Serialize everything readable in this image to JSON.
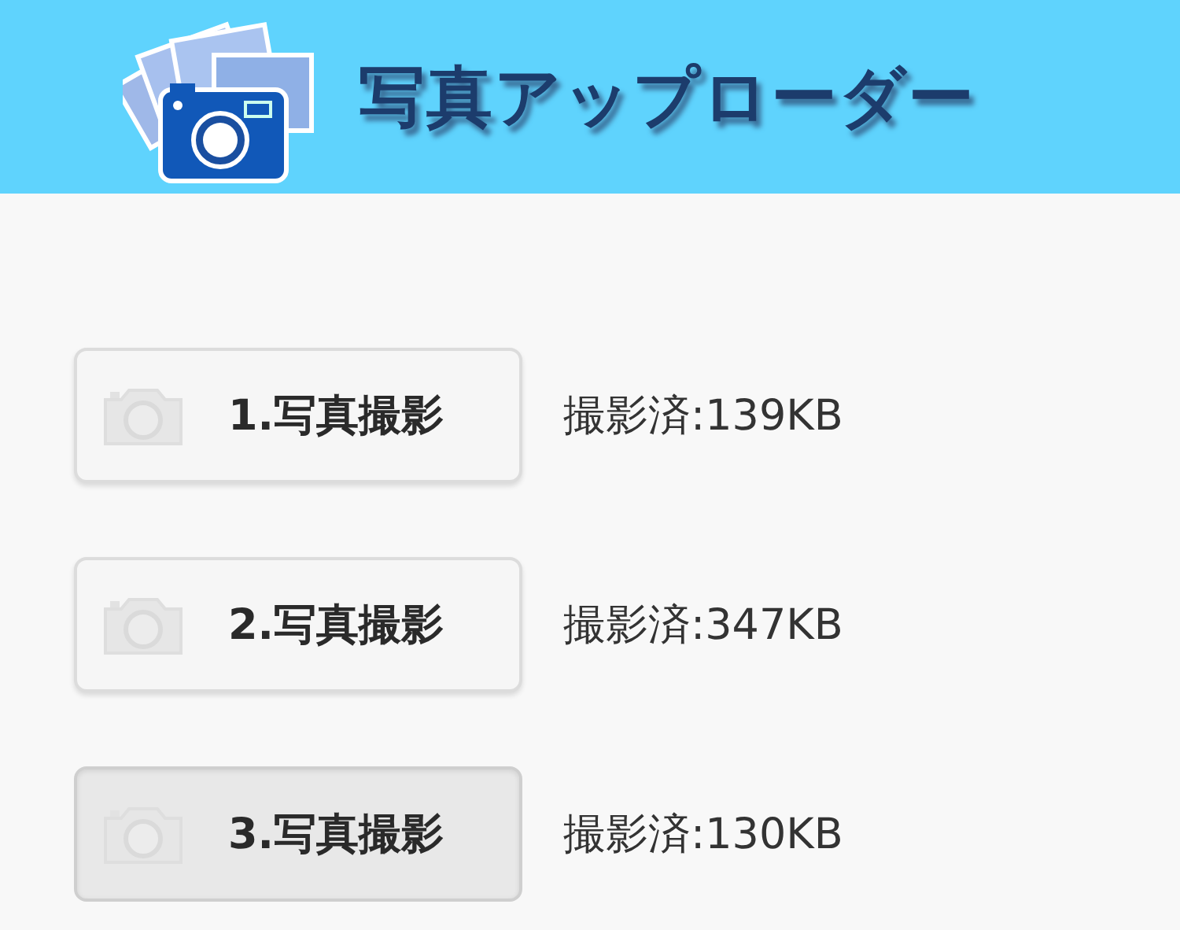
{
  "header": {
    "title": "写真アップローダー"
  },
  "photos": [
    {
      "button": "1.写真撮影",
      "pressed": false,
      "status": "撮影済:139KB"
    },
    {
      "button": "2.写真撮影",
      "pressed": false,
      "status": "撮影済:347KB"
    },
    {
      "button": "3.写真撮影",
      "pressed": true,
      "status": "撮影済:130KB"
    }
  ]
}
